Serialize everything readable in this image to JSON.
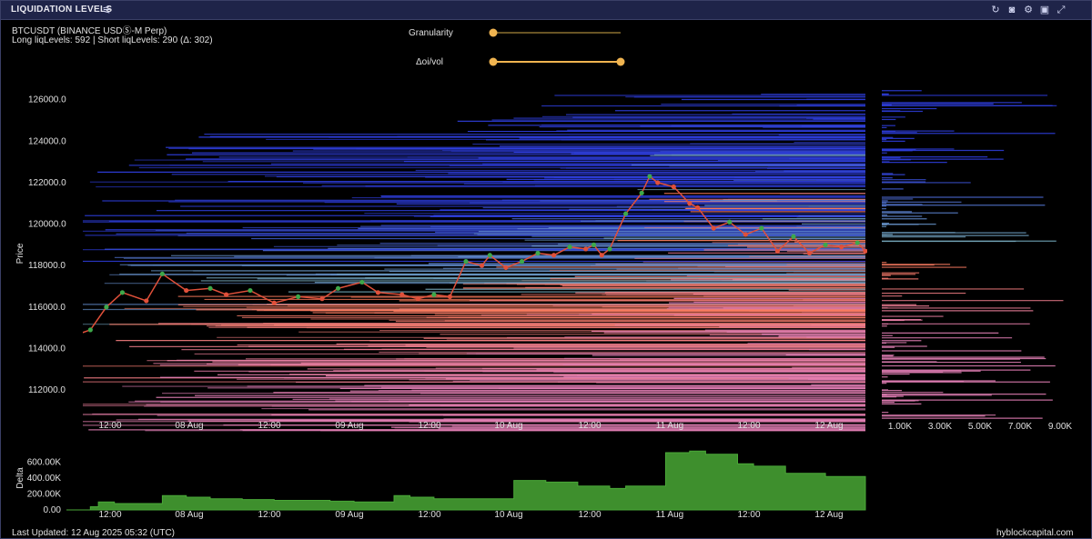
{
  "panel": {
    "title": "LIQUIDATION LEVELS",
    "symbol": "BTCUSDT (BINANCE USDⓈ-M Perp)",
    "levels_summary": "Long liqLevels: 592 | Short liqLevels: 290 (Δ: 302)"
  },
  "controls": {
    "granularity": {
      "label": "Granularity",
      "value": 0.0
    },
    "oi_vol": {
      "label": "Δoi/vol",
      "value_low": 0.0,
      "value_high": 1.0
    }
  },
  "toolbar_icons": [
    "refresh-icon",
    "camera-icon",
    "gear-icon",
    "save-icon",
    "expand-icon"
  ],
  "footer": {
    "last_updated": "Last Updated: 12 Aug 2025 05:32 (UTC)",
    "brand": "hyblockcapital.com"
  },
  "colors": {
    "short_levels": "#2f3fe0",
    "short_levels_near": "#7fb8b8",
    "long_levels_near": "#ff7a4f",
    "long_levels_far": "#e37fb6",
    "candle_up": "#3ea84a",
    "candle_down": "#e0503a",
    "delta_fill": "#3e8f2d"
  },
  "chart_data": [
    {
      "type": "heatmap",
      "title": "",
      "ylabel": "Price",
      "ylim": [
        110600,
        126600
      ],
      "yticks": [
        "126000.0",
        "124000.0",
        "122000.0",
        "120000.0",
        "118000.0",
        "116000.0",
        "114000.0",
        "112000.0"
      ],
      "xticks": [
        "12:00",
        "08 Aug",
        "12:00",
        "09 Aug",
        "12:00",
        "10 Aug",
        "12:00",
        "11 Aug",
        "12:00",
        "12 Aug"
      ],
      "series": [
        {
          "x": [
            0,
            0.3,
            0.5,
            0.7,
            1.0,
            1.2,
            1.5,
            1.8,
            2.0,
            2.3,
            2.6,
            2.9,
            3.2,
            3.4,
            3.7,
            3.9,
            4.2,
            4.4,
            4.6,
            4.8,
            5.0,
            5.2,
            5.3,
            5.5,
            5.7,
            5.9,
            6.1,
            6.3,
            6.5,
            6.6,
            6.7,
            6.8,
            7.0,
            7.2,
            7.3,
            7.4,
            7.6,
            7.8,
            7.9,
            8.1,
            8.3,
            8.5,
            8.7,
            8.9,
            9.1,
            9.3,
            9.5,
            9.7,
            9.9,
            10.0
          ],
          "values": [
            114500,
            114900,
            116000,
            116700,
            116300,
            117600,
            116800,
            116900,
            116600,
            116800,
            116200,
            116500,
            116400,
            116900,
            117200,
            116700,
            116600,
            116400,
            116600,
            116500,
            118200,
            118000,
            118500,
            117900,
            118200,
            118600,
            118500,
            118900,
            118800,
            119000,
            118500,
            118800,
            120500,
            121500,
            122300,
            122000,
            121800,
            121000,
            120800,
            119800,
            120100,
            119500,
            119800,
            118700,
            119400,
            118600,
            119000,
            118900,
            119100,
            118700
          ]
        }
      ],
      "cells": []
    },
    {
      "type": "bar",
      "title": "",
      "xticks": [
        "1.00K",
        "3.00K",
        "5.00K",
        "7.00K",
        "9.00K"
      ],
      "xlim": [
        0,
        10000
      ],
      "values": []
    },
    {
      "type": "area",
      "title": "",
      "ylabel": "Delta",
      "ylim": [
        0,
        800000
      ],
      "yticks": [
        "600.00K",
        "400.00K",
        "200.00K",
        "0.00"
      ],
      "xticks": [
        "12:00",
        "08 Aug",
        "12:00",
        "09 Aug",
        "12:00",
        "10 Aug",
        "12:00",
        "11 Aug",
        "12:00",
        "12 Aug"
      ],
      "x": [
        0,
        0.3,
        0.4,
        0.6,
        1.0,
        1.2,
        1.5,
        1.8,
        2.2,
        2.6,
        3.0,
        3.3,
        3.6,
        3.9,
        4.1,
        4.3,
        4.6,
        5.0,
        5.4,
        5.6,
        6.0,
        6.4,
        6.8,
        7.0,
        7.3,
        7.5,
        7.8,
        8.0,
        8.4,
        8.6,
        8.8,
        9.0,
        9.5,
        10.0
      ],
      "values": [
        0,
        40000,
        100000,
        80000,
        80000,
        180000,
        160000,
        140000,
        130000,
        120000,
        120000,
        110000,
        100000,
        100000,
        180000,
        160000,
        140000,
        140000,
        140000,
        370000,
        350000,
        300000,
        270000,
        300000,
        300000,
        720000,
        740000,
        700000,
        580000,
        550000,
        550000,
        460000,
        420000,
        420000
      ]
    }
  ]
}
